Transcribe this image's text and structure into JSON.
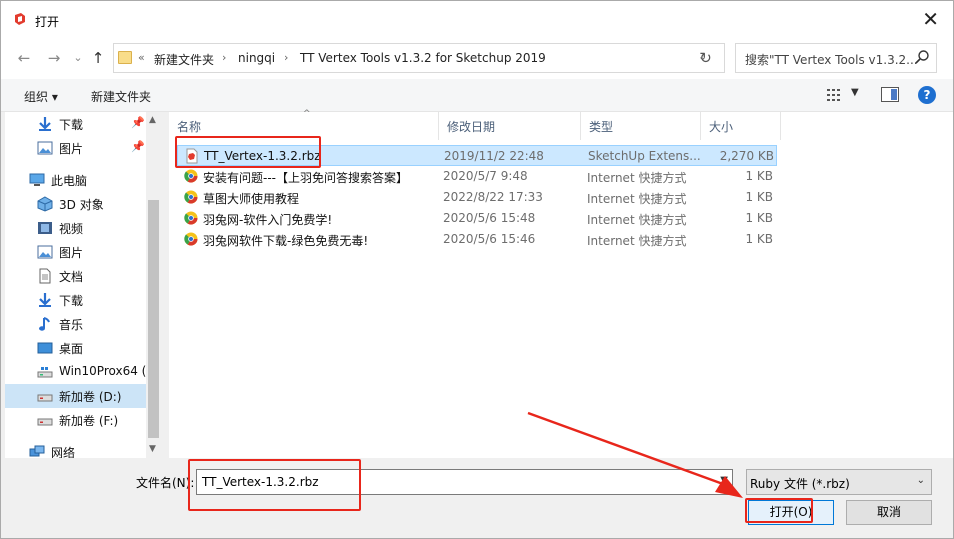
{
  "window": {
    "title": "打开",
    "close_glyph": "✕"
  },
  "nav": {
    "back_icon": "←",
    "forward_icon": "→",
    "recent_icon": "⌄",
    "up_icon": "↑",
    "breadcrumb": [
      "新建文件夹",
      "ningqi",
      "TT Vertex Tools v1.3.2 for Sketchup 2019"
    ],
    "breadcrumb_prefix": "«",
    "refresh_icon": "↻",
    "search_placeholder": "搜索\"TT Vertex Tools v1.3.2..."
  },
  "toolbar": {
    "organize": "组织 ▾",
    "new_folder": "新建文件夹",
    "help": "?"
  },
  "sidebar": {
    "items": [
      {
        "label": "下载",
        "icon": "download-icon",
        "pinned": true
      },
      {
        "label": "图片",
        "icon": "pictures-icon",
        "pinned": true
      },
      {
        "label": "此电脑",
        "icon": "this-pc-icon"
      },
      {
        "label": "3D 对象",
        "icon": "3d-objects-icon"
      },
      {
        "label": "视频",
        "icon": "videos-icon"
      },
      {
        "label": "图片",
        "icon": "pictures-icon"
      },
      {
        "label": "文档",
        "icon": "documents-icon"
      },
      {
        "label": "下载",
        "icon": "download-icon"
      },
      {
        "label": "音乐",
        "icon": "music-icon"
      },
      {
        "label": "桌面",
        "icon": "desktop-icon"
      },
      {
        "label": "Win10Prox64 (",
        "icon": "drive-icon"
      },
      {
        "label": "新加卷 (D:)",
        "icon": "drive-icon",
        "selected": true
      },
      {
        "label": "新加卷 (F:)",
        "icon": "drive-icon"
      },
      {
        "label": "网络",
        "icon": "network-icon"
      }
    ]
  },
  "filelist": {
    "columns": [
      "名称",
      "修改日期",
      "类型",
      "大小"
    ],
    "rows": [
      {
        "name": "TT_Vertex-1.3.2.rbz",
        "date": "2019/11/2 22:48",
        "type": "SketchUp Extens...",
        "size": "2,270 KB",
        "icon": "rbz-file-icon",
        "selected": true
      },
      {
        "name": "安装有问题---【上羽免问答搜索答案】",
        "date": "2020/5/7 9:48",
        "type": "Internet 快捷方式",
        "size": "1 KB",
        "icon": "internet-shortcut-icon"
      },
      {
        "name": "草图大师使用教程",
        "date": "2022/8/22 17:33",
        "type": "Internet 快捷方式",
        "size": "1 KB",
        "icon": "internet-shortcut-icon"
      },
      {
        "name": "羽兔网-软件入门免费学!",
        "date": "2020/5/6 15:48",
        "type": "Internet 快捷方式",
        "size": "1 KB",
        "icon": "internet-shortcut-icon"
      },
      {
        "name": "羽兔网软件下载-绿色免费无毒!",
        "date": "2020/5/6 15:46",
        "type": "Internet 快捷方式",
        "size": "1 KB",
        "icon": "internet-shortcut-icon"
      }
    ]
  },
  "footer": {
    "filename_label": "文件名(N):",
    "filename_value": "TT_Vertex-1.3.2.rbz",
    "filetype_value": "Ruby 文件 (*.rbz)",
    "open_button": "打开(O)",
    "cancel_button": "取消"
  },
  "colors": {
    "annotation": "#e8261b",
    "selection": "#cce8ff",
    "accent": "#0078d7"
  }
}
